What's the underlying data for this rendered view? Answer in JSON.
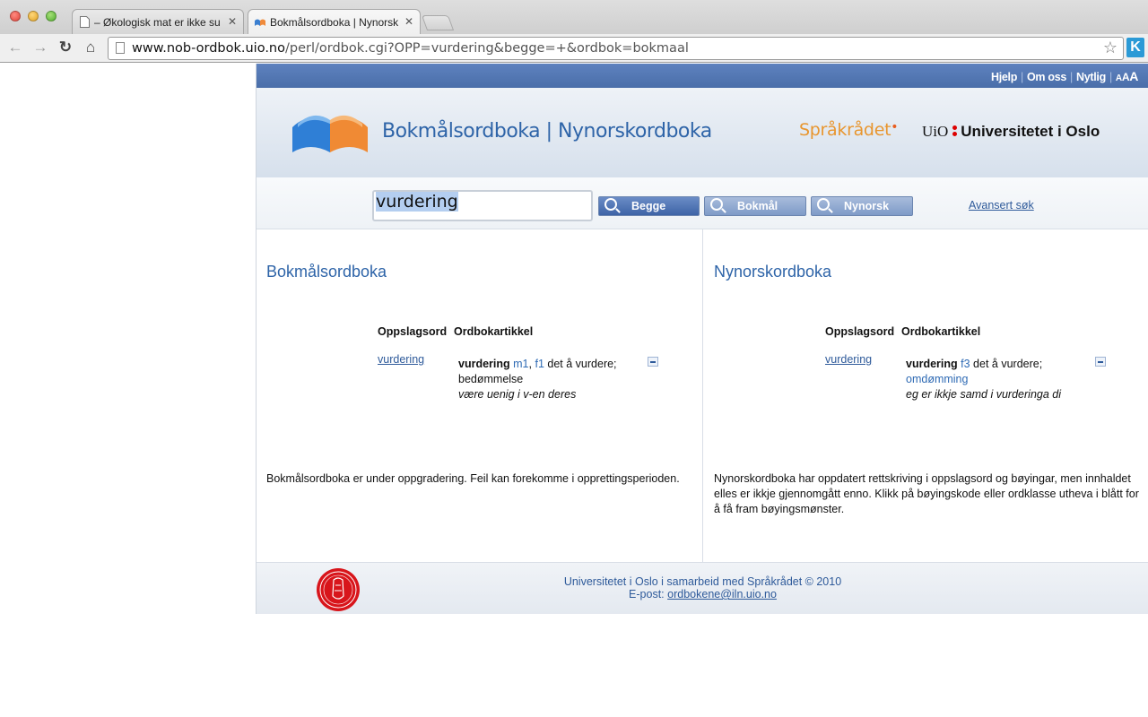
{
  "browser": {
    "tabs": [
      {
        "title": "– Økologisk mat er ikke su",
        "active": false
      },
      {
        "title": "Bokmålsordboka | Nynorsk",
        "active": true
      }
    ],
    "tab_close": "✕",
    "url_host": "www.nob-ordbok.uio.no",
    "url_path": "/perl/ordbok.cgi?OPP=vurdering&begge=+&ordbok=bokmaal",
    "ext_label": "K"
  },
  "topnav": {
    "links": [
      "Hjelp",
      "Om oss",
      "Nytlig"
    ],
    "sep": "|",
    "aaa": [
      "A",
      "A",
      "A"
    ]
  },
  "header": {
    "title": "Bokmålsordboka | Nynorskordboka",
    "partner": "Språkrådet",
    "uio_abbr": "UiO",
    "uio_name": "Universitetet i Oslo"
  },
  "search": {
    "query": "vurdering",
    "buttons": [
      "Begge",
      "Bokmål",
      "Nynorsk"
    ],
    "advanced": "Avansert søk"
  },
  "columns": {
    "headers": [
      "Oppslagsord",
      "Ordbokartikkel"
    ],
    "bokmal": {
      "title": "Bokmålsordboka",
      "lemma": "vurdering",
      "headword": "vurdering",
      "gram1": "m1",
      "comma": ",",
      "gram2": "f1",
      "definition": " det å vurdere; bedømmelse",
      "example": "være uenig i v-en deres",
      "note": "Bokmålsordboka er under oppgradering. Feil kan forekomme i opprettingsperioden."
    },
    "nynorsk": {
      "title": "Nynorskordboka",
      "lemma": "vurdering",
      "headword": "vurdering",
      "gram1": "f3",
      "definition": " det å vurdere;",
      "synonym": "omdømming",
      "example": "eg er ikkje samd i vurderinga di",
      "note": "Nynorskordboka har oppdatert rettskriving i oppslagsord og bøyingar, men innhaldet elles er ikkje gjennomgått enno. Klikk på bøyingskode eller ordklasse utheva i blått for å få fram bøyingsmønster."
    }
  },
  "footer": {
    "line1": "Universitetet i Oslo i samarbeid med Språkrådet © 2010",
    "email_label": "E-post:",
    "email": "ordbokene@iln.uio.no"
  },
  "colors": {
    "accent_blue": "#2e64a8",
    "nav_bar": "#4a6ea9",
    "partner_orange": "#e8962f",
    "uio_red": "#dd0000"
  }
}
